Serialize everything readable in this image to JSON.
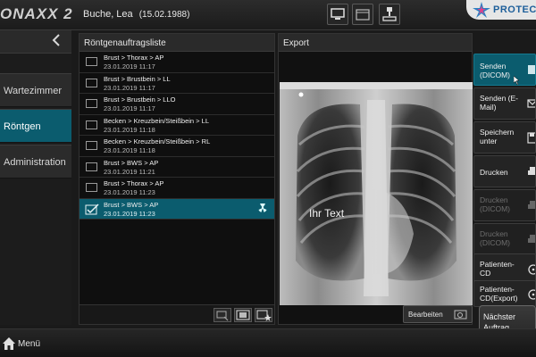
{
  "app": {
    "brand": "ONAXX 2",
    "logo_text": "PROTEC"
  },
  "patient": {
    "name": "Buche, Lea",
    "dob": "(15.02.1988)"
  },
  "sidebar": {
    "back_icon": "chevron-left-icon",
    "items": [
      {
        "label": "Wartezimmer",
        "active": false
      },
      {
        "label": "Röntgen",
        "active": true
      },
      {
        "label": "Administration",
        "active": false
      }
    ]
  },
  "list": {
    "title": "Röntgenauftragsliste",
    "rows": [
      {
        "title": "Brust > Thorax > AP",
        "date": "23.01.2019 11:17",
        "selected": false
      },
      {
        "title": "Brust > Brustbein > LL",
        "date": "23.01.2019 11:17",
        "selected": false
      },
      {
        "title": "Brust > Brustbein > LLO",
        "date": "23.01.2019 11:17",
        "selected": false
      },
      {
        "title": "Becken > Kreuzbein/Steißbein > LL",
        "date": "23.01.2019 11:18",
        "selected": false
      },
      {
        "title": "Becken > Kreuzbein/Steißbein > RL",
        "date": "23.01.2019 11:18",
        "selected": false
      },
      {
        "title": "Brust > BWS > AP",
        "date": "23.01.2019 11:21",
        "selected": false
      },
      {
        "title": "Brust > Thorax > AP",
        "date": "23.01.2019 11:23",
        "selected": false
      },
      {
        "title": "Brust > BWS > AP",
        "date": "23.01.2019 11:23",
        "selected": true
      }
    ]
  },
  "export": {
    "title": "Export",
    "image_text": "Ihr Text",
    "edit_label": "Bearbeiten"
  },
  "actions": [
    {
      "label": "Senden (DICOM)",
      "state": "primary"
    },
    {
      "label": "Senden (E-Mail)",
      "state": "normal"
    },
    {
      "label": "Speichern unter",
      "state": "normal"
    },
    {
      "label": "Drucken",
      "state": "normal"
    },
    {
      "label": "Drucken (DICOM)",
      "state": "disabled"
    },
    {
      "label": "Drucken (DICOM)",
      "state": "disabled"
    },
    {
      "label": "Patienten-CD",
      "state": "normal"
    },
    {
      "label": "Patienten-CD(Export)",
      "state": "normal"
    }
  ],
  "next_label": "Nächster Auftrag",
  "menu_label": "Menü",
  "colors": {
    "accent": "#0b5c6e",
    "background": "#1a1a1a",
    "panel": "#111111"
  }
}
